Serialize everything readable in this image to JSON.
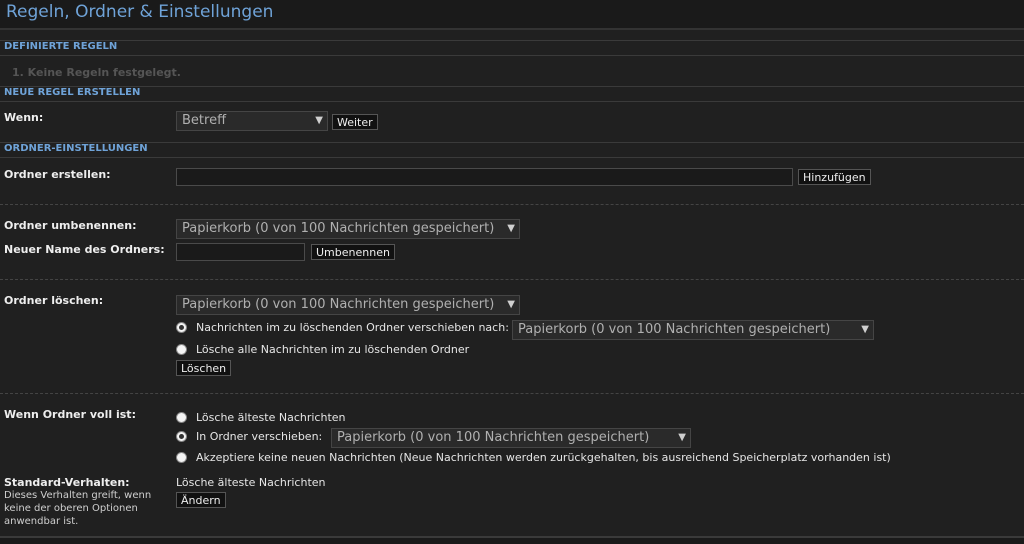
{
  "header": {
    "title": "Regeln, Ordner & Einstellungen"
  },
  "sections": {
    "defined_rules": "DEFINIERTE REGELN",
    "new_rule": "NEUE REGEL ERSTELLEN",
    "folder_settings": "ORDNER-EINSTELLUNGEN"
  },
  "rules": {
    "empty_text": "1.  Keine Regeln festgelegt."
  },
  "new_rule": {
    "when_label": "Wenn:",
    "when_value": "Betreff",
    "next_button": "Weiter"
  },
  "create_folder": {
    "label": "Ordner erstellen:",
    "value": "",
    "add_button": "Hinzufügen"
  },
  "rename_folder": {
    "label": "Ordner umbenennen:",
    "folder_value": "Papierkorb (0 von 100 Nachrichten gespeichert)",
    "new_name_label": "Neuer Name des Ordners:",
    "new_name_value": "",
    "rename_button": "Umbenennen"
  },
  "delete_folder": {
    "label": "Ordner löschen:",
    "folder_value": "Papierkorb (0 von 100 Nachrichten gespeichert)",
    "move_option": "Nachrichten im zu löschenden Ordner verschieben nach:",
    "move_target": "Papierkorb (0 von 100 Nachrichten gespeichert)",
    "delete_all_option": "Lösche alle Nachrichten im zu löschenden Ordner",
    "delete_button": "Löschen"
  },
  "folder_full": {
    "label": "Wenn Ordner voll ist:",
    "option_delete_oldest": "Lösche älteste Nachrichten",
    "option_move": "In Ordner verschieben:",
    "move_target": "Papierkorb (0 von 100 Nachrichten gespeichert)",
    "option_accept_none": "Akzeptiere keine neuen Nachrichten (Neue Nachrichten werden zurückgehalten, bis ausreichend Speicherplatz vorhanden ist)"
  },
  "default_behavior": {
    "label": "Standard-Verhalten:",
    "description": "Dieses Verhalten greift, wenn keine der oberen Optionen anwendbar ist.",
    "value": "Lösche älteste Nachrichten",
    "change_button": "Ändern"
  }
}
